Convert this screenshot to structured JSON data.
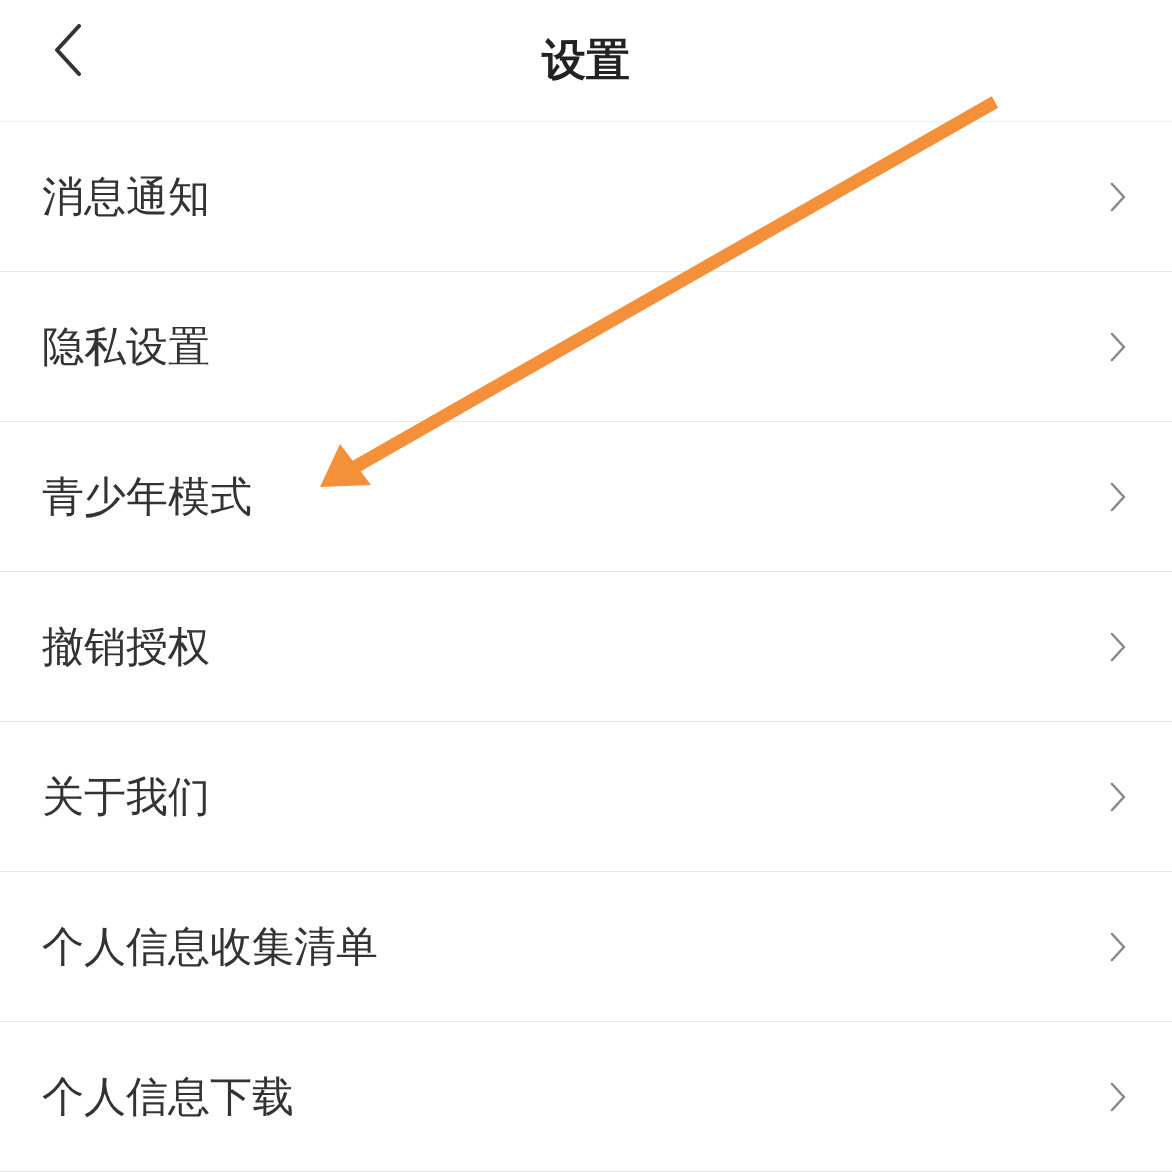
{
  "header": {
    "title": "设置"
  },
  "items": [
    {
      "label": "消息通知"
    },
    {
      "label": "隐私设置"
    },
    {
      "label": "青少年模式"
    },
    {
      "label": "撤销授权"
    },
    {
      "label": "关于我们"
    },
    {
      "label": "个人信息收集清单"
    },
    {
      "label": "个人信息下载"
    }
  ]
}
